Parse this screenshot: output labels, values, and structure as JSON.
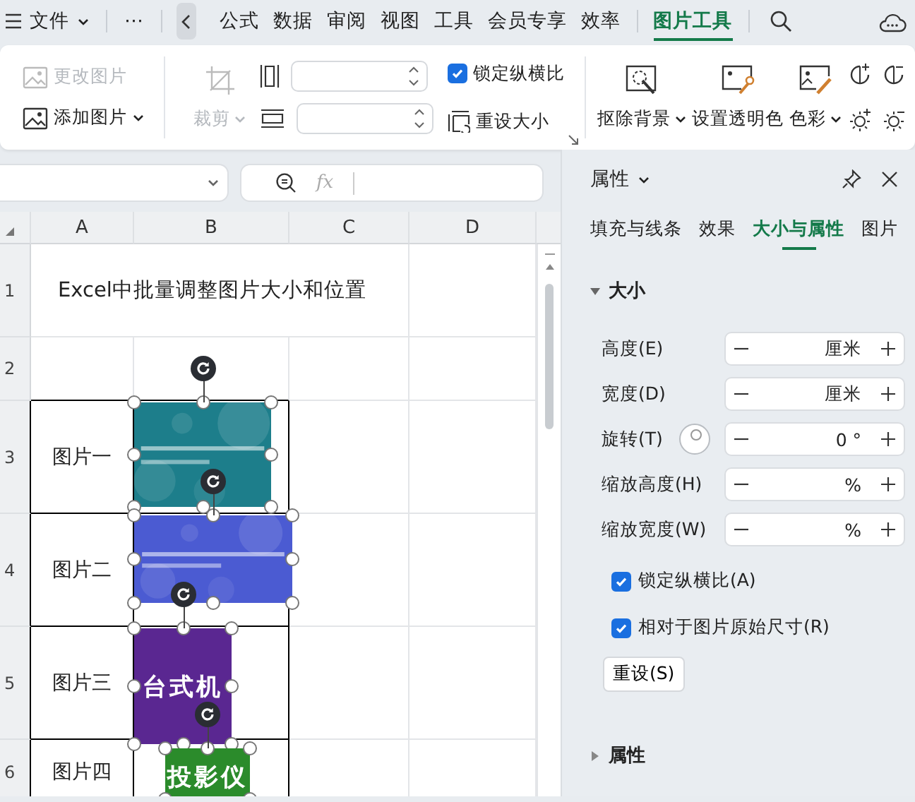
{
  "menu_bar": {
    "file_menu": "文件",
    "more": "⋯",
    "tabs": [
      {
        "label": "公式",
        "selected": false
      },
      {
        "label": "数据",
        "selected": false
      },
      {
        "label": "审阅",
        "selected": false
      },
      {
        "label": "视图",
        "selected": false
      },
      {
        "label": "工具",
        "selected": false
      },
      {
        "label": "会员专享",
        "selected": false
      },
      {
        "label": "效率",
        "selected": false
      },
      {
        "label": "图片工具",
        "selected": true
      }
    ]
  },
  "ribbon": {
    "picture_commands": [
      {
        "label": "更改图片",
        "disabled": true,
        "dropdown": false
      },
      {
        "label": "添加图片",
        "disabled": false,
        "dropdown": true
      }
    ],
    "crop": {
      "label": "裁剪",
      "disabled": true
    },
    "lock_aspect_ratio": {
      "label": "锁定纵横比",
      "checked": true
    },
    "reset_size": {
      "label": "重设大小"
    },
    "tools": [
      {
        "kind": "remove_background",
        "label": "抠除背景",
        "dropdown": true
      },
      {
        "kind": "transparent_color",
        "label": "设置透明色",
        "dropdown": false
      },
      {
        "kind": "color",
        "label": "色彩",
        "dropdown": true
      }
    ]
  },
  "formula_bar": {
    "function_label": "fx"
  },
  "sheet": {
    "columns": [
      "A",
      "B",
      "C",
      "D"
    ],
    "row_numbers": [
      "1",
      "2",
      "3",
      "4",
      "5",
      "6"
    ],
    "title_cell": "Excel中批量调整图片大小和位置",
    "item_labels": [
      "图片一",
      "图片二",
      "图片三",
      "图片四"
    ],
    "images": [
      {
        "kind": "picture",
        "color": "#1d7e8b"
      },
      {
        "kind": "picture",
        "color": "#4b5bd2"
      },
      {
        "kind": "banner",
        "color": "#5a2791",
        "caption": "台式机"
      },
      {
        "kind": "banner",
        "color": "#2b8b2b",
        "caption": "投影仪"
      }
    ]
  },
  "panel": {
    "title": "属性",
    "tabs": [
      {
        "label": "填充与线条",
        "selected": false
      },
      {
        "label": "效果",
        "selected": false
      },
      {
        "label": "大小与属性",
        "selected": true
      },
      {
        "label": "图片",
        "selected": false
      }
    ],
    "sections": [
      {
        "title": "大小",
        "expanded": true,
        "fields": [
          {
            "kind": "spin",
            "label": "高度(E)",
            "value": "厘米"
          },
          {
            "kind": "spin",
            "label": "宽度(D)",
            "value": "厘米"
          },
          {
            "kind": "rotation",
            "label": "旋转(T)",
            "value": "0 °"
          },
          {
            "kind": "spin",
            "label": "缩放高度(H)",
            "value": "%"
          },
          {
            "kind": "spin",
            "label": "缩放宽度(W)",
            "value": "%"
          }
        ],
        "options": [
          {
            "label": "锁定纵横比(A)",
            "checked": true
          },
          {
            "label": "相对于图片原始尺寸(R)",
            "checked": true
          }
        ],
        "button": "重设(S)"
      },
      {
        "title": "属性",
        "expanded": false
      }
    ]
  }
}
